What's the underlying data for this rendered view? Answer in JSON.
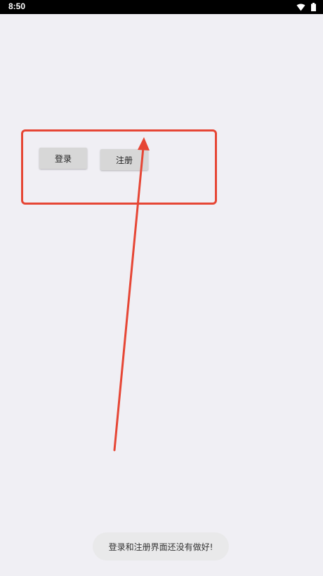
{
  "status_bar": {
    "time": "8:50"
  },
  "buttons": {
    "login_label": "登录",
    "register_label": "注册"
  },
  "toast": {
    "message": "登录和注册界面还没有做好!"
  },
  "annotation": {
    "color": "#e64635"
  }
}
